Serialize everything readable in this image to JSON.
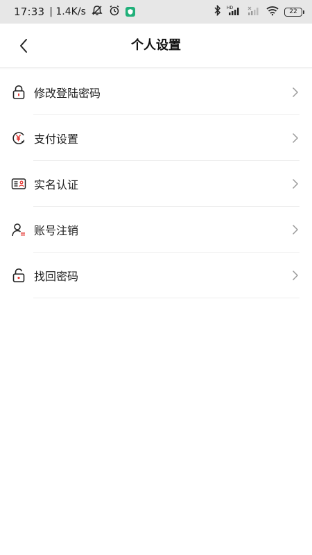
{
  "status_bar": {
    "time": "17:33",
    "network_speed": "| 1.4K/s",
    "signal_label": "HD",
    "battery": "22"
  },
  "nav": {
    "title": "个人设置"
  },
  "menu": {
    "items": [
      {
        "label": "修改登陆密码",
        "icon": "lock-icon"
      },
      {
        "label": "支付设置",
        "icon": "payment-icon"
      },
      {
        "label": "实名认证",
        "icon": "id-card-icon"
      },
      {
        "label": "账号注销",
        "icon": "user-icon"
      },
      {
        "label": "找回密码",
        "icon": "unlock-icon"
      }
    ]
  },
  "colors": {
    "accent": "#e53b36",
    "text": "#222222",
    "divider": "#ececec"
  }
}
